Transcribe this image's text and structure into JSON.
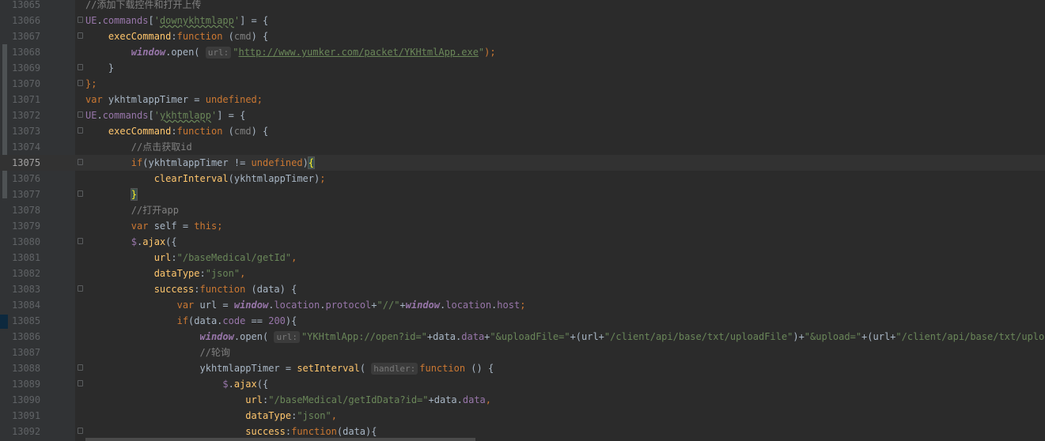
{
  "editor": {
    "lines": [
      {
        "num": "13065",
        "tokens": [
          {
            "t": "//添加下载控件和打开上传",
            "c": "cm"
          }
        ]
      },
      {
        "num": "13066",
        "tokens": [
          {
            "t": "UE",
            "c": "prop"
          },
          {
            "t": ".",
            "c": ""
          },
          {
            "t": "commands",
            "c": "prop"
          },
          {
            "t": "[",
            "c": ""
          },
          {
            "t": "'",
            "c": "str"
          },
          {
            "t": "downykhtmlapp",
            "c": "str typo"
          },
          {
            "t": "'",
            "c": "str"
          },
          {
            "t": "] = {",
            "c": ""
          }
        ]
      },
      {
        "num": "13067",
        "tokens": [
          {
            "t": "    ",
            "c": ""
          },
          {
            "t": "execCommand",
            "c": "fn"
          },
          {
            "t": ":",
            "c": ""
          },
          {
            "t": "function",
            "c": "kw"
          },
          {
            "t": " (",
            "c": ""
          },
          {
            "t": "cmd",
            "c": "cm"
          },
          {
            "t": ") {",
            "c": ""
          }
        ]
      },
      {
        "num": "13068",
        "tokens": [
          {
            "t": "        ",
            "c": ""
          },
          {
            "t": "window",
            "c": "glob"
          },
          {
            "t": ".",
            "c": ""
          },
          {
            "t": "open",
            "c": ""
          },
          {
            "t": "( ",
            "c": ""
          },
          {
            "t": "url:",
            "c": "hint"
          },
          {
            "t": "\"",
            "c": "str"
          },
          {
            "t": "http://www.yumker.com/packet/YKHtmlApp.exe",
            "c": "link"
          },
          {
            "t": "\"",
            "c": "str"
          },
          {
            "t": ");",
            "c": "kw"
          }
        ]
      },
      {
        "num": "13069",
        "tokens": [
          {
            "t": "    }",
            "c": ""
          }
        ]
      },
      {
        "num": "13070",
        "tokens": [
          {
            "t": "};",
            "c": "kw"
          }
        ]
      },
      {
        "num": "13071",
        "tokens": [
          {
            "t": "var ",
            "c": "kw"
          },
          {
            "t": "ykhtmlappTimer",
            "c": ""
          },
          {
            "t": " = ",
            "c": ""
          },
          {
            "t": "undefined",
            "c": "kw"
          },
          {
            "t": ";",
            "c": "kw"
          }
        ]
      },
      {
        "num": "13072",
        "tokens": [
          {
            "t": "UE",
            "c": "prop"
          },
          {
            "t": ".",
            "c": ""
          },
          {
            "t": "commands",
            "c": "prop"
          },
          {
            "t": "[",
            "c": ""
          },
          {
            "t": "'",
            "c": "str"
          },
          {
            "t": "ykhtmlapp",
            "c": "str typo"
          },
          {
            "t": "'",
            "c": "str"
          },
          {
            "t": "] = {",
            "c": ""
          }
        ]
      },
      {
        "num": "13073",
        "tokens": [
          {
            "t": "    ",
            "c": ""
          },
          {
            "t": "execCommand",
            "c": "fn"
          },
          {
            "t": ":",
            "c": ""
          },
          {
            "t": "function",
            "c": "kw"
          },
          {
            "t": " (",
            "c": ""
          },
          {
            "t": "cmd",
            "c": "cm"
          },
          {
            "t": ") {",
            "c": ""
          }
        ]
      },
      {
        "num": "13074",
        "tokens": [
          {
            "t": "        ",
            "c": ""
          },
          {
            "t": "//点击获取id",
            "c": "cm"
          }
        ]
      },
      {
        "num": "13075",
        "current": true,
        "tokens": [
          {
            "t": "        ",
            "c": ""
          },
          {
            "t": "if",
            "c": "kw"
          },
          {
            "t": "(ykhtmlappTimer != ",
            "c": ""
          },
          {
            "t": "undefined",
            "c": "kw"
          },
          {
            "t": ")",
            "c": ""
          },
          {
            "t": "{",
            "c": "brace-match"
          }
        ]
      },
      {
        "num": "13076",
        "tokens": [
          {
            "t": "            ",
            "c": ""
          },
          {
            "t": "clearInterval",
            "c": "fn"
          },
          {
            "t": "(ykhtmlappTimer)",
            "c": ""
          },
          {
            "t": ";",
            "c": "kw"
          }
        ]
      },
      {
        "num": "13077",
        "tokens": [
          {
            "t": "        ",
            "c": ""
          },
          {
            "t": "}",
            "c": "brace-match"
          }
        ]
      },
      {
        "num": "13078",
        "tokens": [
          {
            "t": "        ",
            "c": ""
          },
          {
            "t": "//打开app",
            "c": "cm"
          }
        ]
      },
      {
        "num": "13079",
        "tokens": [
          {
            "t": "        ",
            "c": ""
          },
          {
            "t": "var ",
            "c": "kw"
          },
          {
            "t": "self = ",
            "c": ""
          },
          {
            "t": "this",
            "c": "kw"
          },
          {
            "t": ";",
            "c": "kw"
          }
        ]
      },
      {
        "num": "13080",
        "tokens": [
          {
            "t": "        ",
            "c": ""
          },
          {
            "t": "$",
            "c": "dollar"
          },
          {
            "t": ".",
            "c": ""
          },
          {
            "t": "ajax",
            "c": "fn"
          },
          {
            "t": "({",
            "c": ""
          }
        ]
      },
      {
        "num": "13081",
        "tokens": [
          {
            "t": "            ",
            "c": ""
          },
          {
            "t": "url",
            "c": "fn"
          },
          {
            "t": ":",
            "c": ""
          },
          {
            "t": "\"/baseMedical/getId\"",
            "c": "str"
          },
          {
            "t": ",",
            "c": "kw"
          }
        ]
      },
      {
        "num": "13082",
        "tokens": [
          {
            "t": "            ",
            "c": ""
          },
          {
            "t": "dataType",
            "c": "fn"
          },
          {
            "t": ":",
            "c": ""
          },
          {
            "t": "\"json\"",
            "c": "str"
          },
          {
            "t": ",",
            "c": "kw"
          }
        ]
      },
      {
        "num": "13083",
        "tokens": [
          {
            "t": "            ",
            "c": ""
          },
          {
            "t": "success",
            "c": "fn"
          },
          {
            "t": ":",
            "c": ""
          },
          {
            "t": "function",
            "c": "kw"
          },
          {
            "t": " (data) {",
            "c": ""
          }
        ]
      },
      {
        "num": "13084",
        "tokens": [
          {
            "t": "                ",
            "c": ""
          },
          {
            "t": "var ",
            "c": "kw"
          },
          {
            "t": "url = ",
            "c": ""
          },
          {
            "t": "window",
            "c": "glob"
          },
          {
            "t": ".",
            "c": ""
          },
          {
            "t": "location",
            "c": "prop"
          },
          {
            "t": ".",
            "c": ""
          },
          {
            "t": "protocol",
            "c": "prop"
          },
          {
            "t": "+",
            "c": ""
          },
          {
            "t": "\"//\"",
            "c": "str"
          },
          {
            "t": "+",
            "c": ""
          },
          {
            "t": "window",
            "c": "glob"
          },
          {
            "t": ".",
            "c": ""
          },
          {
            "t": "location",
            "c": "prop"
          },
          {
            "t": ".",
            "c": ""
          },
          {
            "t": "host",
            "c": "prop"
          },
          {
            "t": ";",
            "c": "kw"
          }
        ]
      },
      {
        "num": "13085",
        "tokens": [
          {
            "t": "                ",
            "c": ""
          },
          {
            "t": "if",
            "c": "kw"
          },
          {
            "t": "(data.",
            "c": ""
          },
          {
            "t": "code",
            "c": "prop"
          },
          {
            "t": " == ",
            "c": ""
          },
          {
            "t": "200",
            "c": "prop"
          },
          {
            "t": "){",
            "c": ""
          }
        ]
      },
      {
        "num": "13086",
        "tokens": [
          {
            "t": "                    ",
            "c": ""
          },
          {
            "t": "window",
            "c": "glob"
          },
          {
            "t": ".",
            "c": ""
          },
          {
            "t": "open",
            "c": ""
          },
          {
            "t": "( ",
            "c": ""
          },
          {
            "t": "url:",
            "c": "hint"
          },
          {
            "t": "\"YKHtmlApp://open?id=\"",
            "c": "str"
          },
          {
            "t": "+data.",
            "c": ""
          },
          {
            "t": "data",
            "c": "prop"
          },
          {
            "t": "+",
            "c": ""
          },
          {
            "t": "\"&uploadFile=\"",
            "c": "str"
          },
          {
            "t": "+(url+",
            "c": ""
          },
          {
            "t": "\"/client/api/base/txt/uploadFile\"",
            "c": "str"
          },
          {
            "t": ")+",
            "c": ""
          },
          {
            "t": "\"&upload=\"",
            "c": "str"
          },
          {
            "t": "+(url+",
            "c": ""
          },
          {
            "t": "\"/client/api/base/txt/upload\"",
            "c": "str"
          },
          {
            "t": "));",
            "c": ""
          }
        ]
      },
      {
        "num": "13087",
        "tokens": [
          {
            "t": "                    ",
            "c": ""
          },
          {
            "t": "//轮询",
            "c": "cm"
          }
        ]
      },
      {
        "num": "13088",
        "tokens": [
          {
            "t": "                    ",
            "c": ""
          },
          {
            "t": "ykhtmlappTimer = ",
            "c": ""
          },
          {
            "t": "setInterval",
            "c": "fn"
          },
          {
            "t": "( ",
            "c": ""
          },
          {
            "t": "handler:",
            "c": "hint"
          },
          {
            "t": "function",
            "c": "kw"
          },
          {
            "t": " () {",
            "c": ""
          }
        ]
      },
      {
        "num": "13089",
        "tokens": [
          {
            "t": "                        ",
            "c": ""
          },
          {
            "t": "$",
            "c": "dollar"
          },
          {
            "t": ".",
            "c": ""
          },
          {
            "t": "ajax",
            "c": "fn"
          },
          {
            "t": "({",
            "c": ""
          }
        ]
      },
      {
        "num": "13090",
        "tokens": [
          {
            "t": "                            ",
            "c": ""
          },
          {
            "t": "url",
            "c": "fn"
          },
          {
            "t": ":",
            "c": ""
          },
          {
            "t": "\"/baseMedical/getIdData?id=\"",
            "c": "str"
          },
          {
            "t": "+data.",
            "c": ""
          },
          {
            "t": "data",
            "c": "prop"
          },
          {
            "t": ",",
            "c": "kw"
          }
        ]
      },
      {
        "num": "13091",
        "tokens": [
          {
            "t": "                            ",
            "c": ""
          },
          {
            "t": "dataType",
            "c": "fn"
          },
          {
            "t": ":",
            "c": ""
          },
          {
            "t": "\"json\"",
            "c": "str"
          },
          {
            "t": ",",
            "c": "kw"
          }
        ]
      },
      {
        "num": "13092",
        "tokens": [
          {
            "t": "                            ",
            "c": ""
          },
          {
            "t": "success",
            "c": "fn"
          },
          {
            "t": ":",
            "c": ""
          },
          {
            "t": "function",
            "c": "kw"
          },
          {
            "t": "(data){",
            "c": ""
          }
        ]
      }
    ],
    "fold_markers": [
      "13066",
      "13067",
      "13069",
      "13070",
      "13072",
      "13073",
      "13075",
      "13077",
      "13080",
      "13083",
      "13088",
      "13089",
      "13092"
    ]
  }
}
